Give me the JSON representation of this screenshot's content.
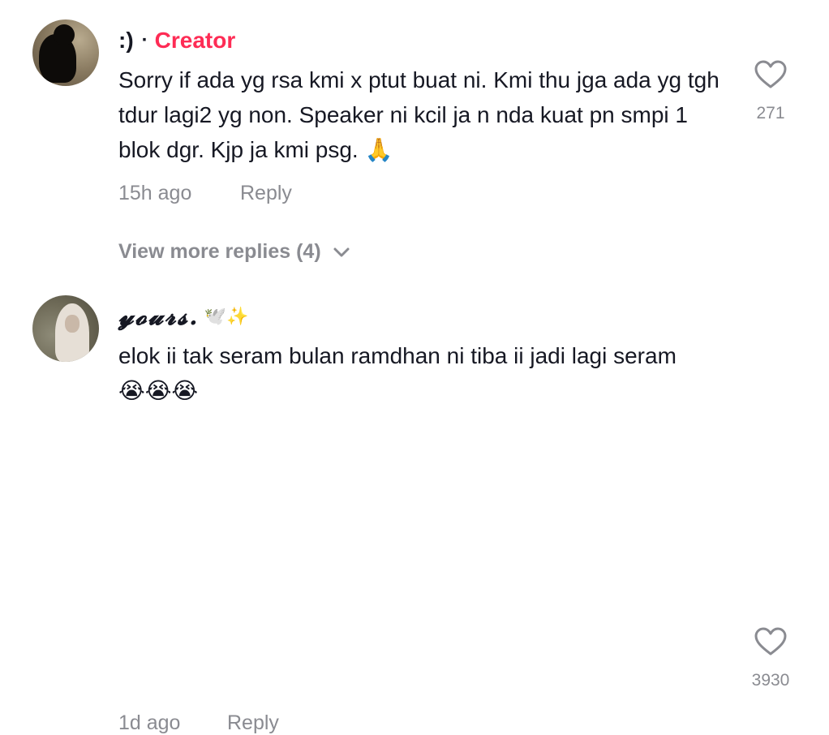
{
  "comments": [
    {
      "username": ":)",
      "badge_separator": "·",
      "badge": "Creator",
      "text": "Sorry if ada yg rsa kmi x ptut buat ni. Kmi thu jga ada yg tgh tdur lagi2 yg non. Speaker ni kcil ja n nda kuat pn smpi 1 blok dgr. Kjp ja kmi psg. 🙏",
      "time": "15h ago",
      "reply_label": "Reply",
      "likes": "271"
    },
    {
      "username": "𝔂𝓸𝓾𝓻𝓼.",
      "username_emoji": "🕊️✨",
      "text": "elok ii tak seram bulan ramdhan ni tiba ii jadi lagi seram 😭😭😭",
      "time": "1d ago",
      "reply_label": "Reply",
      "likes": "3930"
    }
  ],
  "view_more_replies": "View more replies (4)",
  "colors": {
    "creator_accent": "#fe2c55",
    "secondary_text": "#8a8b91",
    "primary_text": "#161823"
  },
  "icons": {
    "like": "heart-outline-icon",
    "expand": "chevron-down-icon"
  }
}
